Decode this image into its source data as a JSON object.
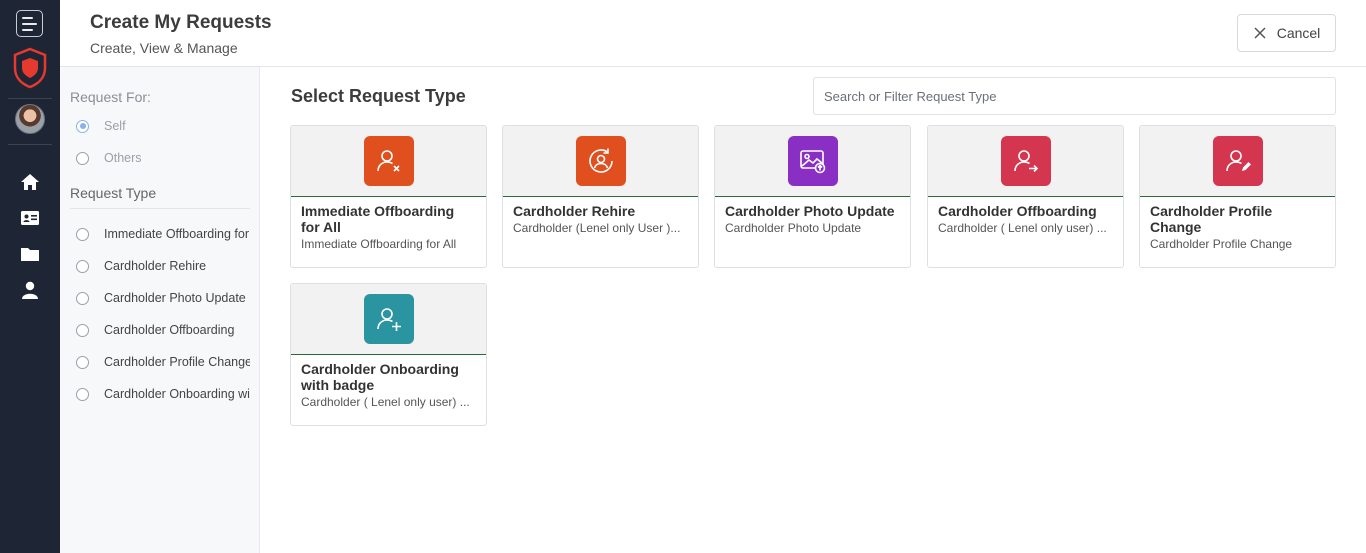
{
  "header": {
    "title": "Create My Requests",
    "subtitle": "Create, View & Manage",
    "cancel_label": "Cancel"
  },
  "filters": {
    "request_for_label": "Request For:",
    "request_for_options": [
      {
        "label": "Self",
        "selected": true
      },
      {
        "label": "Others",
        "selected": false
      }
    ],
    "request_type_label": "Request Type",
    "request_type_options": [
      {
        "label": "Immediate Offboarding for All"
      },
      {
        "label": "Cardholder Rehire"
      },
      {
        "label": "Cardholder Photo Update"
      },
      {
        "label": "Cardholder Offboarding"
      },
      {
        "label": "Cardholder Profile Change"
      },
      {
        "label": "Cardholder Onboarding with badge"
      }
    ]
  },
  "main": {
    "title": "Select Request Type",
    "search_placeholder": "Search or Filter Request Type",
    "cards": [
      {
        "name": "Immediate Offboarding for All",
        "desc": "Immediate Offboarding for All",
        "icon": "user-remove-icon",
        "color": "#e0501f"
      },
      {
        "name": "Cardholder Rehire",
        "desc": "Cardholder (Lenel only User )...",
        "icon": "user-rehire-icon",
        "color": "#e0501f"
      },
      {
        "name": "Cardholder Photo Update",
        "desc": "Cardholder Photo Update",
        "icon": "photo-upload-icon",
        "color": "#8a2fc4"
      },
      {
        "name": "Cardholder Offboarding",
        "desc": "Cardholder ( Lenel only user) ...",
        "icon": "user-exit-icon",
        "color": "#d4364f"
      },
      {
        "name": "Cardholder Profile Change",
        "desc": "Cardholder Profile Change",
        "icon": "user-edit-icon",
        "color": "#d4364f"
      },
      {
        "name": "Cardholder Onboarding with badge",
        "desc": "Cardholder ( Lenel only user) ...",
        "icon": "user-add-icon",
        "color": "#2a95a0"
      }
    ]
  },
  "nav": {
    "items": [
      "home-icon",
      "id-card-icon",
      "folder-icon",
      "user-icon"
    ],
    "accent": "#e8392e"
  }
}
